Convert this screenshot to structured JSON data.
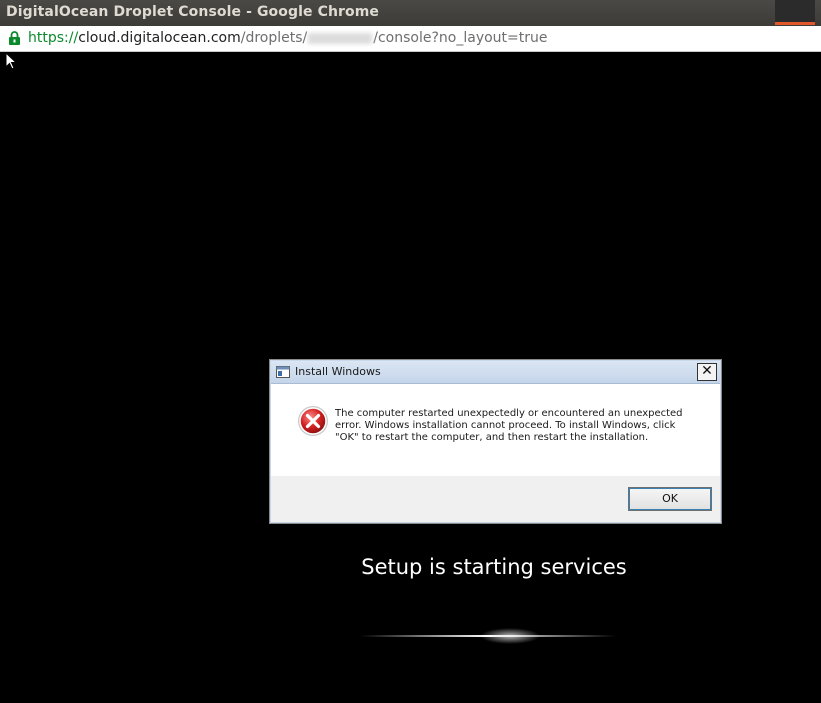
{
  "window": {
    "title": "DigitalOcean Droplet Console - Google Chrome"
  },
  "address_bar": {
    "scheme": "https://",
    "host": "cloud.digitalocean.com",
    "path_prefix": "/droplets/",
    "path_suffix": "/console?no_layout=true",
    "lock_icon": "lock-icon"
  },
  "dialog": {
    "title": "Install Windows",
    "close_label": "✕",
    "error_icon": "error-icon",
    "message": "The computer restarted unexpectedly or encountered an unexpected error. Windows installation cannot proceed. To install Windows, click \"OK\" to restart the computer, and then restart the installation.",
    "ok_label": "OK"
  },
  "console": {
    "status_text": "Setup is starting services"
  },
  "colors": {
    "background": "#000000",
    "scheme_green": "#0b8a2c",
    "error_red": "#d21f1f"
  }
}
